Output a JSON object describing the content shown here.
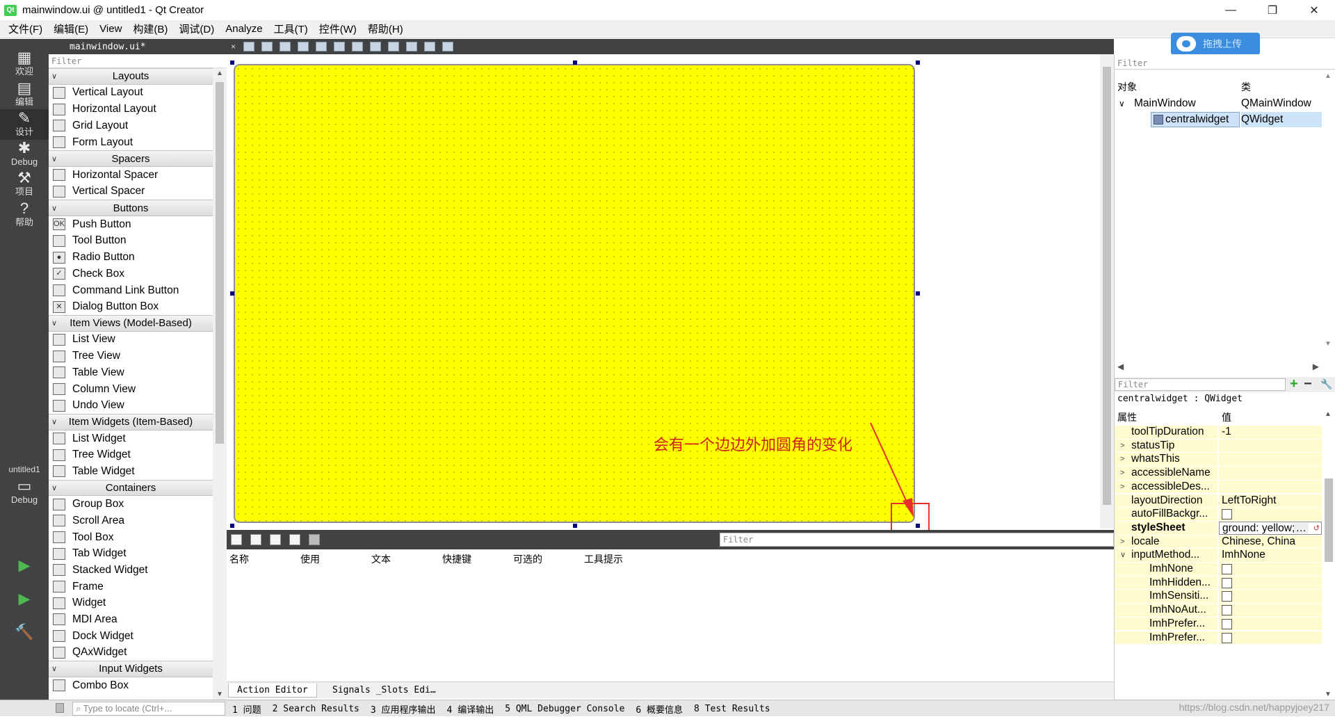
{
  "window": {
    "title": "mainwindow.ui @ untitled1 - Qt Creator",
    "app_icon_text": "Qt",
    "minimize": "—",
    "maximize": "❐",
    "close": "✕"
  },
  "menu": [
    "文件(F)",
    "编辑(E)",
    "View",
    "构建(B)",
    "调试(D)",
    "Analyze",
    "工具(T)",
    "控件(W)",
    "帮助(H)"
  ],
  "upload_badge": "拖拽上传",
  "modes": [
    {
      "icon": "grid-icon",
      "glyph": "▦",
      "label": "欢迎"
    },
    {
      "icon": "edit-icon",
      "glyph": "▤",
      "label": "编辑"
    },
    {
      "icon": "design-icon",
      "glyph": "✎",
      "label": "设计"
    },
    {
      "icon": "debug-icon",
      "glyph": "✱",
      "label": "Debug"
    },
    {
      "icon": "wrench-icon",
      "glyph": "⚒",
      "label": "项目"
    },
    {
      "icon": "help-icon",
      "glyph": "?",
      "label": "帮助"
    }
  ],
  "project_target": {
    "name": "untitled1",
    "icon": "monitor-icon",
    "glyph": "▭",
    "label": "Debug"
  },
  "run_buttons": [
    {
      "icon": "run-icon",
      "glyph": "▶"
    },
    {
      "icon": "debug-run-icon",
      "glyph": "▶"
    },
    {
      "icon": "build-icon",
      "glyph": "🔨"
    }
  ],
  "editor_tab": {
    "label": "mainwindow.ui*",
    "close": "×"
  },
  "widget_box": {
    "filter_placeholder": "Filter",
    "categories": [
      {
        "name": "Layouts",
        "items": [
          "Vertical Layout",
          "Horizontal Layout",
          "Grid Layout",
          "Form Layout"
        ]
      },
      {
        "name": "Spacers",
        "items": [
          "Horizontal Spacer",
          "Vertical Spacer"
        ]
      },
      {
        "name": "Buttons",
        "items": [
          "Push Button",
          "Tool Button",
          "Radio Button",
          "Check Box",
          "Command Link Button",
          "Dialog Button Box"
        ]
      },
      {
        "name": "Item Views (Model-Based)",
        "items": [
          "List View",
          "Tree View",
          "Table View",
          "Column View",
          "Undo View"
        ]
      },
      {
        "name": "Item Widgets (Item-Based)",
        "items": [
          "List Widget",
          "Tree Widget",
          "Table Widget"
        ]
      },
      {
        "name": "Containers",
        "items": [
          "Group Box",
          "Scroll Area",
          "Tool Box",
          "Tab Widget",
          "Stacked Widget",
          "Frame",
          "Widget",
          "MDI Area",
          "Dock Widget",
          "QAxWidget"
        ]
      },
      {
        "name": "Input Widgets",
        "items": [
          "Combo Box"
        ]
      }
    ]
  },
  "form": {
    "background": "#ffff00",
    "annotation": "会有一个边边外加圆角的变化"
  },
  "action_editor": {
    "filter_placeholder": "Filter",
    "columns": [
      "名称",
      "使用",
      "文本",
      "快捷键",
      "可选的",
      "工具提示"
    ],
    "tabs": [
      "Action Editor",
      "Signals _Slots Edi…"
    ]
  },
  "object_inspector": {
    "filter_placeholder": "Filter",
    "columns": [
      "对象",
      "类"
    ],
    "rows": [
      {
        "object": "MainWindow",
        "class": "QMainWindow",
        "expander": "∨"
      },
      {
        "object": "centralwidget",
        "class": "QWidget",
        "selected": true
      }
    ]
  },
  "property_editor": {
    "filter_placeholder": "Filter",
    "add": "+",
    "remove": "−",
    "tool": "🔧",
    "object_label": "centralwidget : QWidget",
    "columns": [
      "属性",
      "值"
    ],
    "rows": [
      {
        "name": "toolTipDuration",
        "value": "-1"
      },
      {
        "name": "statusTip",
        "value": "",
        "expander": ">"
      },
      {
        "name": "whatsThis",
        "value": "",
        "expander": ">"
      },
      {
        "name": "accessibleName",
        "value": "",
        "expander": ">"
      },
      {
        "name": "accessibleDes...",
        "value": "",
        "expander": ">"
      },
      {
        "name": "layoutDirection",
        "value": "LeftToRight"
      },
      {
        "name": "autoFillBackgr...",
        "value": "",
        "checkbox": true
      },
      {
        "name": "styleSheet",
        "value": "ground: yellow;",
        "bold": true,
        "edit": true
      },
      {
        "name": "locale",
        "value": "Chinese, China",
        "expander": ">"
      },
      {
        "name": "inputMethod...",
        "value": "ImhNone",
        "expander": "∨"
      },
      {
        "name": "ImhNone",
        "value": "",
        "checkbox": true,
        "sub": true
      },
      {
        "name": "ImhHidden...",
        "value": "",
        "checkbox": true,
        "sub": true
      },
      {
        "name": "ImhSensiti...",
        "value": "",
        "checkbox": true,
        "sub": true
      },
      {
        "name": "ImhNoAut...",
        "value": "",
        "checkbox": true,
        "sub": true
      },
      {
        "name": "ImhPrefer...",
        "value": "",
        "checkbox": true,
        "sub": true
      },
      {
        "name": "ImhPrefer...",
        "value": "",
        "checkbox": true,
        "sub": true
      }
    ]
  },
  "statusbar": {
    "locator_placeholder": "Type to locate (Ctrl+...",
    "items": [
      "1 问题",
      "2 Search Results",
      "3 应用程序输出",
      "4 编译输出",
      "5 QML Debugger Console",
      "6 概要信息",
      "8 Test Results"
    ],
    "watermark": "https://blog.csdn.net/happyjoey217"
  }
}
